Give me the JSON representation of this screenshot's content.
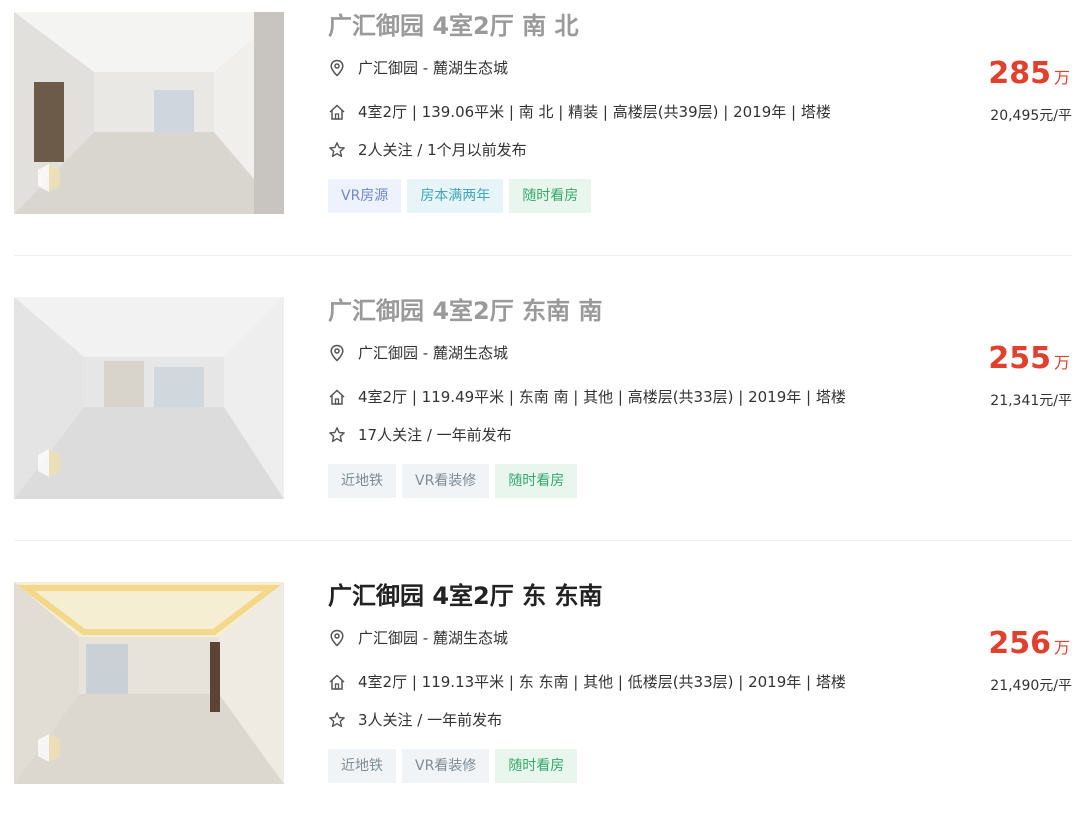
{
  "listings": [
    {
      "title": "广汇御园 4室2厅 南 北",
      "community": "广汇御园",
      "separator": " - ",
      "area": "麓湖生态城",
      "info": "4室2厅 | 139.06平米 | 南 北 | 精装 | 高楼层(共39层) | 2019年 | 塔楼",
      "follow": "2人关注 / 1个月以前发布",
      "tags": [
        "VR房源",
        "房本满两年",
        "随时看房"
      ],
      "price": "285",
      "price_unit": "万",
      "unit_price": "20,495元/平"
    },
    {
      "title": "广汇御园 4室2厅 东南 南",
      "community": "广汇御园",
      "separator": " - ",
      "area": "麓湖生态城",
      "info": "4室2厅 | 119.49平米 | 东南 南 | 其他 | 高楼层(共33层) | 2019年 | 塔楼",
      "follow": "17人关注 / 一年前发布",
      "tags": [
        "近地铁",
        "VR看装修",
        "随时看房"
      ],
      "price": "255",
      "price_unit": "万",
      "unit_price": "21,341元/平"
    },
    {
      "title": "广汇御园 4室2厅 东 东南",
      "community": "广汇御园",
      "separator": " - ",
      "area": "麓湖生态城",
      "info": "4室2厅 | 119.13平米 | 东 东南 | 其他 | 低楼层(共33层) | 2019年 | 塔楼",
      "follow": "3人关注 / 一年前发布",
      "tags": [
        "近地铁",
        "VR看装修",
        "随时看房"
      ],
      "price": "256",
      "price_unit": "万",
      "unit_price": "21,490元/平"
    }
  ],
  "icons": {
    "location": "location-pin-icon",
    "house": "house-icon",
    "star": "star-icon",
    "vr": "vr-badge-icon"
  },
  "colors": {
    "price": "#e0402e",
    "title_visited": "#9a9a9a",
    "title": "#222222",
    "tag_vr": "#6f87d4",
    "tag_green": "#35a86b"
  }
}
